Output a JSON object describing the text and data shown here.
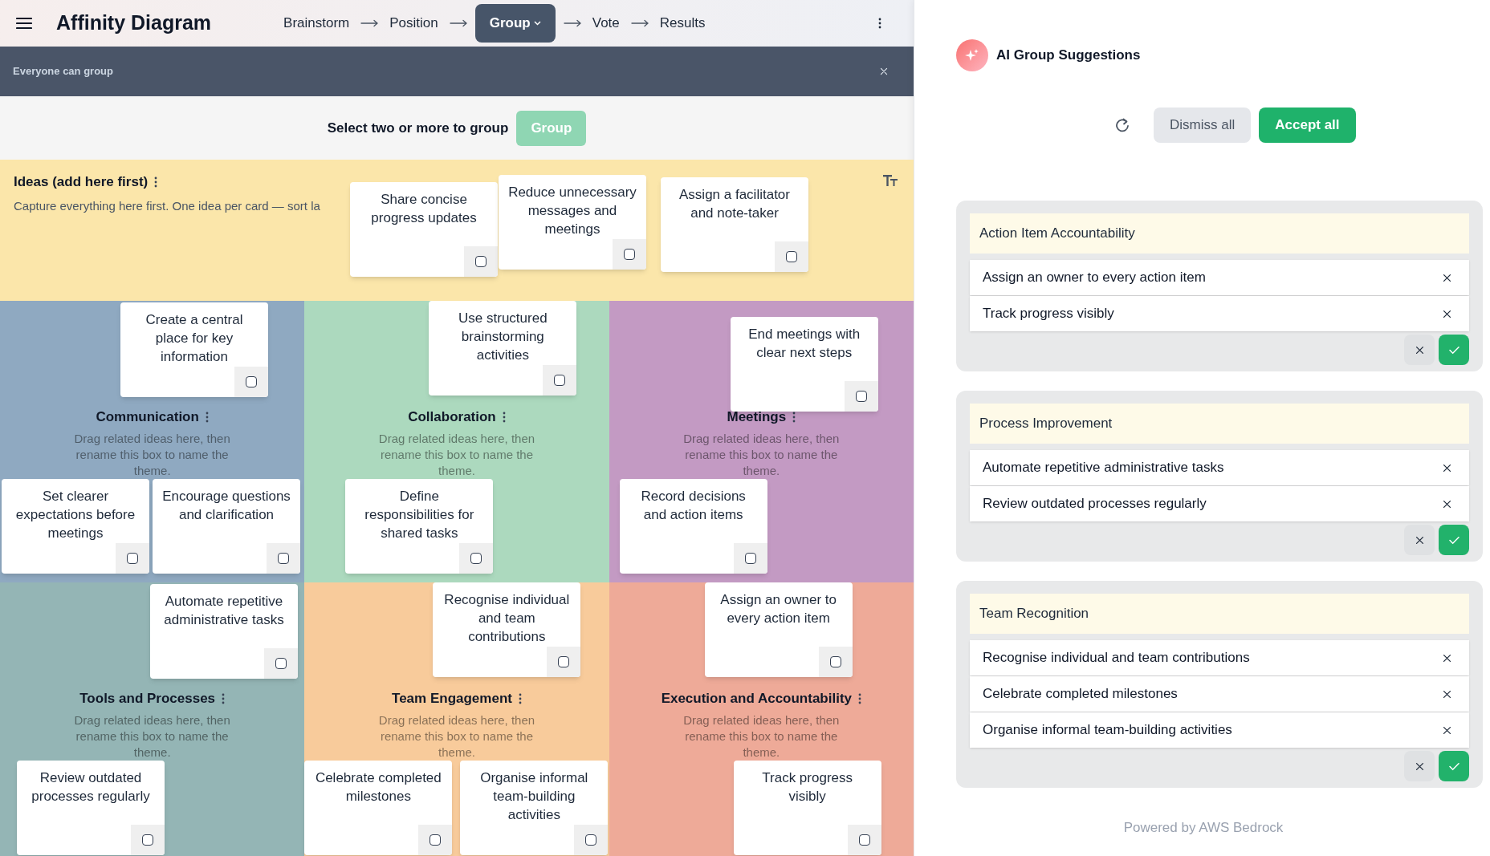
{
  "header": {
    "title": "Affinity Diagram",
    "steps": [
      {
        "label": "Brainstorm",
        "selected": false
      },
      {
        "label": "Position",
        "selected": false
      },
      {
        "label": "Group",
        "selected": true
      },
      {
        "label": "Vote",
        "selected": false
      },
      {
        "label": "Results",
        "selected": false
      }
    ]
  },
  "banner": {
    "text": "Everyone can group"
  },
  "selection_bar": {
    "prompt": "Select two or more to group",
    "button": {
      "label": "Group",
      "disabled": true
    }
  },
  "ideas_zone": {
    "title": "Ideas (add here first)",
    "hint": "Capture everything here first. One idea per card — sort la",
    "cards": [
      {
        "text": "Share concise progress updates",
        "checked": false
      },
      {
        "text": "Reduce unnecessary messages and meetings",
        "checked": false
      },
      {
        "text": "Assign a facilitator and note-taker",
        "checked": false
      }
    ]
  },
  "groups": [
    {
      "title": "Communication",
      "color": "#8fa9c1",
      "hint": "Drag related ideas here, then rename this box to name the theme.",
      "cards": [
        {
          "text": "Create a central place for key information",
          "checked": false
        },
        {
          "text": "Set clearer expectations before meetings",
          "checked": false
        },
        {
          "text": "Encourage questions and clarification",
          "checked": false
        }
      ]
    },
    {
      "title": "Collaboration",
      "color": "#acd9be",
      "hint": "Drag related ideas here, then rename this box to name the theme.",
      "cards": [
        {
          "text": "Use structured brainstorming activities",
          "checked": false
        },
        {
          "text": "Define responsibilities for shared tasks",
          "checked": false
        }
      ]
    },
    {
      "title": "Meetings",
      "color": "#c39ac3",
      "hint": "Drag related ideas here, then rename this box to name the theme.",
      "cards": [
        {
          "text": "End meetings with clear next steps",
          "checked": false
        },
        {
          "text": "Record decisions and action items",
          "checked": false
        }
      ]
    },
    {
      "title": "Tools and Processes",
      "color": "#94b5b5",
      "hint": "Drag related ideas here, then rename this box to name the theme.",
      "cards": [
        {
          "text": "Automate repetitive administrative tasks",
          "checked": false
        },
        {
          "text": "Review outdated processes regularly",
          "checked": false
        }
      ]
    },
    {
      "title": "Team Engagement",
      "color": "#f8cb9b",
      "hint": "Drag related ideas here, then rename this box to name the theme.",
      "cards": [
        {
          "text": "Recognise individual and team contributions",
          "checked": false
        },
        {
          "text": "Celebrate completed milestones",
          "checked": false
        },
        {
          "text": "Organise informal team-building activities",
          "checked": false
        }
      ]
    },
    {
      "title": "Execution and Accountability",
      "color": "#eeaa98",
      "hint": "Drag related ideas here, then rename this box to name the theme.",
      "cards": [
        {
          "text": "Assign an owner to every action item",
          "checked": false
        },
        {
          "text": "Track progress visibly",
          "checked": false
        }
      ]
    }
  ],
  "suggestions_panel": {
    "title": "AI Group Suggestions",
    "actions": [
      {
        "label": "Dismiss all",
        "kind": "secondary"
      },
      {
        "label": "Accept all",
        "kind": "primary"
      }
    ],
    "suggestions": [
      {
        "title": "Action Item Accountability",
        "items": [
          "Assign an owner to every action item",
          "Track progress visibly"
        ]
      },
      {
        "title": "Process Improvement",
        "items": [
          "Automate repetitive administrative tasks",
          "Review outdated processes regularly"
        ]
      },
      {
        "title": "Team Recognition",
        "items": [
          "Recognise individual and team contributions",
          "Celebrate completed milestones",
          "Organise informal team-building activities"
        ]
      }
    ],
    "footer": "Powered by AWS Bedrock"
  }
}
